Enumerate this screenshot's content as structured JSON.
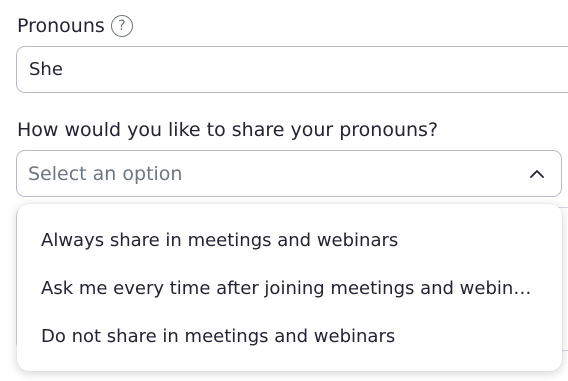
{
  "pronouns": {
    "label": "Pronouns",
    "help_icon_glyph": "?",
    "value": "She"
  },
  "share": {
    "question": "How would you like to share your pronouns?",
    "placeholder": "Select an option",
    "options": [
      {
        "label": "Always share in meetings and webinars"
      },
      {
        "label": "Ask me every time after joining meetings and webinars"
      },
      {
        "label": "Do not share in meetings and webinars"
      }
    ]
  },
  "icons": {
    "help": "question-circle-icon",
    "chevron": "chevron-up-icon"
  },
  "colors": {
    "text": "#232333",
    "placeholder": "#6e7680",
    "border": "#babacc"
  }
}
